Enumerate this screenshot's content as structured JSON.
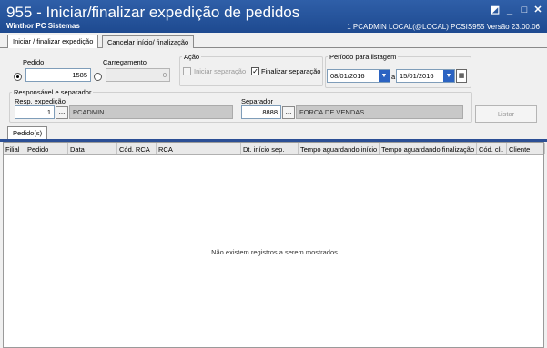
{
  "window": {
    "title": "955 - Iniciar/finalizar expedição de pedidos",
    "subtitle": "Winthor   PC Sistemas",
    "status": "1   PCADMIN   LOCAL(@LOCAL)   PCSIS955   Versão 23.00.06"
  },
  "tabs": [
    {
      "label": "Iniciar / finalizar expedição"
    },
    {
      "label": "Cancelar início/ finalização"
    }
  ],
  "filters": {
    "pedido_label": "Pedido",
    "pedido_value": "1585",
    "carregamento_label": "Carregamento",
    "carregamento_value": "0",
    "acao_label": "Ação",
    "iniciar_label": "Iniciar separação",
    "finalizar_label": "Finalizar separação",
    "periodo_label": "Período para listagem",
    "data_inicio": "08/01/2016",
    "periodo_sep": "a",
    "data_fim": "15/01/2016",
    "resp_group_label": "Responsável e separador",
    "resp_label": "Resp. expedição",
    "resp_code": "1",
    "resp_name": "PCADMIN",
    "separador_label": "Separador",
    "separador_code": "8888",
    "separador_name": "FORCA DE VENDAS",
    "dots": "...",
    "listar_label": "Listar"
  },
  "results": {
    "tab_label": "Pedido(s)",
    "columns": [
      "Filial",
      "Pedido",
      "Data",
      "Cód. RCA",
      "RCA",
      "Dt. início sep.",
      "Tempo aguardando  início",
      "Tempo aguardando finalização",
      "Cód. cli.",
      "Cliente"
    ],
    "empty_message": "Não existem registros a serem mostrados"
  },
  "colors": {
    "titlebar": "#1e4a90",
    "accent_bar": "#2b4f95",
    "dropdown_button": "#2b63c2"
  }
}
